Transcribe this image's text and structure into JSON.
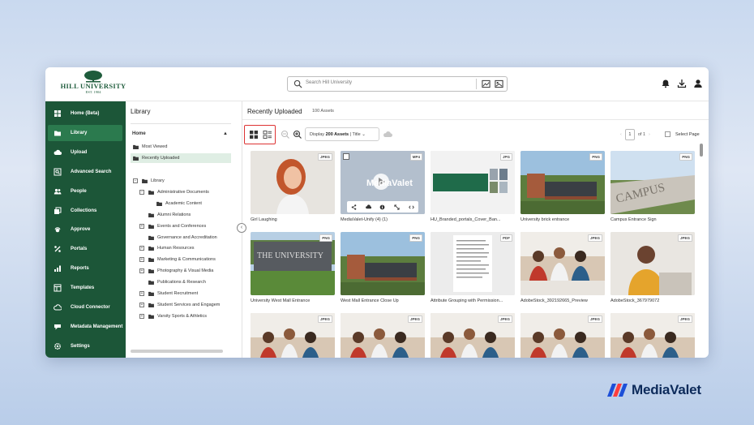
{
  "header": {
    "logo_name": "HILL UNIVERSITY",
    "logo_est": "EST. 1904",
    "search_placeholder": "Search Hill University"
  },
  "sidebar": {
    "items": [
      {
        "label": "Home (Beta)",
        "icon": "home-grid-icon"
      },
      {
        "label": "Library",
        "icon": "folder-icon",
        "active": true
      },
      {
        "label": "Upload",
        "icon": "cloud-upload-icon"
      },
      {
        "label": "Advanced Search",
        "icon": "advanced-search-icon"
      },
      {
        "label": "People",
        "icon": "people-icon"
      },
      {
        "label": "Collections",
        "icon": "collections-icon"
      },
      {
        "label": "Approve",
        "icon": "approve-icon"
      },
      {
        "label": "Portals",
        "icon": "portals-icon"
      },
      {
        "label": "Reports",
        "icon": "reports-icon"
      },
      {
        "label": "Templates",
        "icon": "templates-icon"
      },
      {
        "label": "Cloud Connector",
        "icon": "cloud-connector-icon"
      },
      {
        "label": "Metadata Management",
        "icon": "metadata-icon"
      },
      {
        "label": "Settings",
        "icon": "gear-icon"
      }
    ]
  },
  "library": {
    "title": "Library",
    "home": "Home",
    "quick": [
      "Most Viewed",
      "Recently Uploaded"
    ],
    "tree": [
      {
        "label": "Library",
        "level": 0,
        "pm": "−"
      },
      {
        "label": "Administrative Documents",
        "level": 1,
        "pm": "−"
      },
      {
        "label": "Academic Content",
        "level": 2,
        "pm": ""
      },
      {
        "label": "Alumni Relations",
        "level": 1,
        "pm": ""
      },
      {
        "label": "Events and Conferences",
        "level": 1,
        "pm": "+"
      },
      {
        "label": "Governance and Accreditation",
        "level": 1,
        "pm": ""
      },
      {
        "label": "Human Resources",
        "level": 1,
        "pm": "+"
      },
      {
        "label": "Marketing & Communications",
        "level": 1,
        "pm": "+"
      },
      {
        "label": "Photography & Visual Media",
        "level": 1,
        "pm": "+"
      },
      {
        "label": "Publications & Research",
        "level": 1,
        "pm": ""
      },
      {
        "label": "Student Recruitment",
        "level": 1,
        "pm": "+"
      },
      {
        "label": "Student Services and Engagem",
        "level": 1,
        "pm": "+"
      },
      {
        "label": "Varsity Sports & Athletics",
        "level": 1,
        "pm": "+"
      }
    ]
  },
  "main": {
    "title": "Recently Uploaded",
    "count": "100 Assets",
    "display_prefix": "Display",
    "display_value": "200 Assets",
    "display_sort": "| Title",
    "page_current": "1",
    "page_of": "of 1",
    "select_page": "Select Page"
  },
  "assets": [
    {
      "name": "Girl Laughing",
      "type": "JPEG",
      "scene": "girl"
    },
    {
      "name": "MediaValet-Unify (4) (1)",
      "type": "MP4",
      "scene": "video"
    },
    {
      "name": "HU_Branded_portals_Cover_Ban...",
      "type": "JPG",
      "scene": "banner"
    },
    {
      "name": "University brick entrance",
      "type": "PNG",
      "scene": "brick"
    },
    {
      "name": "Campus Entrance Sign",
      "type": "PNG",
      "scene": "campus"
    },
    {
      "name": "University West Mall Entrance",
      "type": "PNG",
      "scene": "sign"
    },
    {
      "name": "West Mall Entrance Close Up",
      "type": "PNG",
      "scene": "brick"
    },
    {
      "name": "Attribute Grouping with Permission...",
      "type": "PDF",
      "scene": "doc"
    },
    {
      "name": "AdobeStock_392192665_Preview",
      "type": "JPEG",
      "scene": "students"
    },
    {
      "name": "AdobeStock_367979072",
      "type": "JPEG",
      "scene": "guy"
    },
    {
      "name": "",
      "type": "JPEG",
      "scene": "students"
    },
    {
      "name": "",
      "type": "JPEG",
      "scene": "students"
    },
    {
      "name": "",
      "type": "JPEG",
      "scene": "students"
    },
    {
      "name": "",
      "type": "JPEG",
      "scene": "students"
    },
    {
      "name": "",
      "type": "JPEG",
      "scene": "students"
    }
  ],
  "video_overlay_text": "MediaValet",
  "brand": {
    "name": "MediaValet",
    "color": "#0c2a5a"
  },
  "colors": {
    "sidebar": "#1c5638",
    "active": "#2b7a4e",
    "highlight": "#d33333"
  }
}
